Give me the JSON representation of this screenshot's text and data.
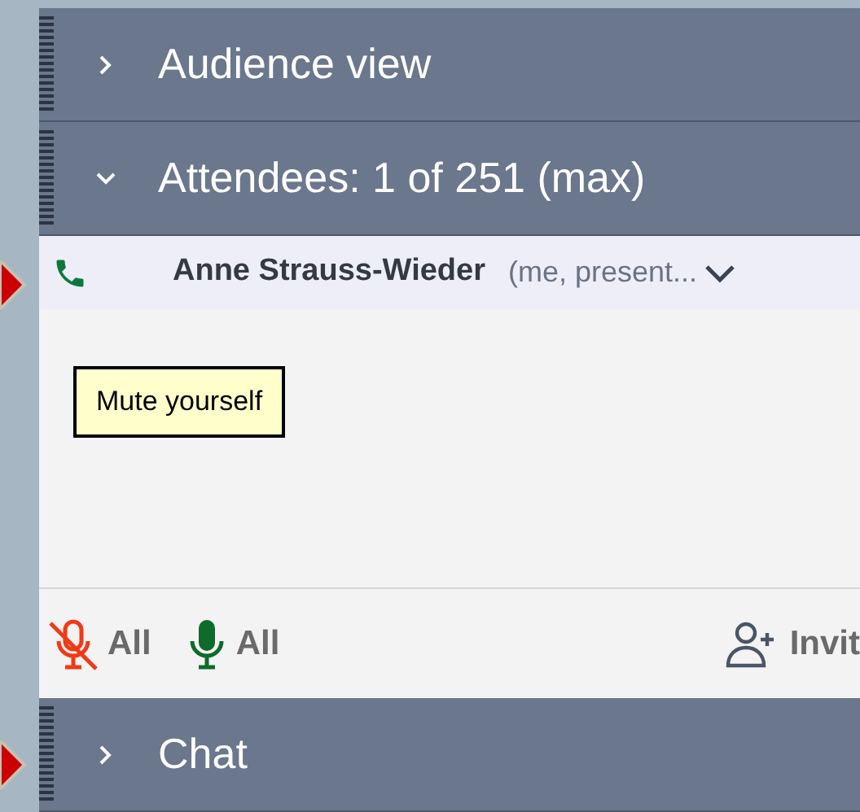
{
  "panels": [
    {
      "title": "Audience view",
      "expanded": false
    },
    {
      "title": "Attendees:  1 of 251 (max)",
      "expanded": true
    }
  ],
  "attendees": [
    {
      "name": "Anne Strauss-Wieder",
      "role": "(me, present...",
      "selected": true
    }
  ],
  "tooltip": "Mute yourself",
  "toolbar": {
    "mute_all": "All",
    "unmute_all": "All",
    "invite": "Invit"
  },
  "bottom_panels": [
    {
      "title": "Chat",
      "expanded": false
    }
  ]
}
